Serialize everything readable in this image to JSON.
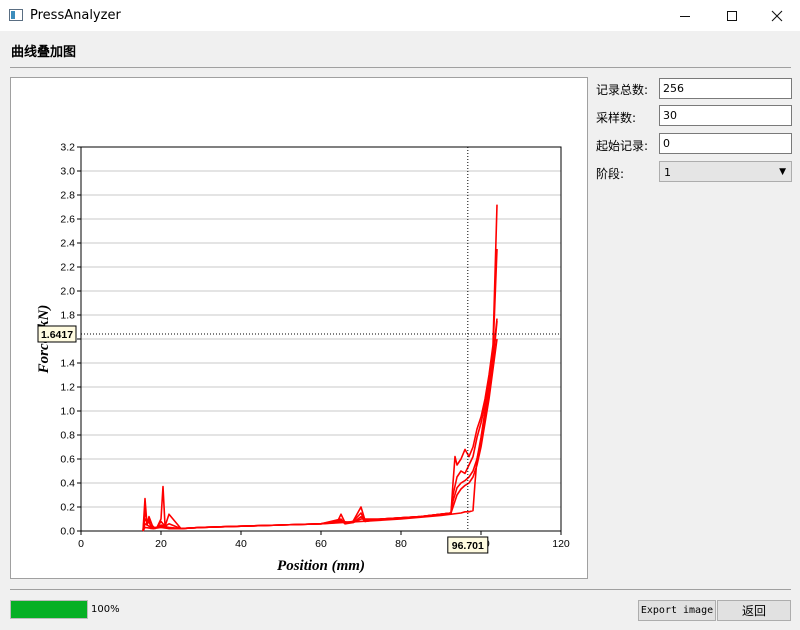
{
  "window": {
    "title": "PressAnalyzer"
  },
  "section_title": "曲线叠加图",
  "fields": {
    "total_records": {
      "label": "记录总数:",
      "value": "256"
    },
    "samples": {
      "label": "采样数:",
      "value": "30"
    },
    "start_record": {
      "label": "起始记录:",
      "value": "0"
    },
    "stage": {
      "label": "阶段:",
      "value": "1"
    }
  },
  "progress": {
    "percent": 100,
    "text": "100%"
  },
  "buttons": {
    "export": "Export image",
    "back": "返回"
  },
  "icons": {
    "minimize": "minimize-icon",
    "maximize": "maximize-icon",
    "close": "close-icon",
    "dropdown": "chevron-down-icon",
    "app": "app-icon"
  },
  "chart_data": {
    "type": "line",
    "xlabel": "Position (mm)",
    "ylabel": "Force (kN)",
    "xlim": [
      0,
      120
    ],
    "ylim": [
      0,
      3.2
    ],
    "xticks": [
      0,
      20,
      40,
      60,
      80,
      100,
      120
    ],
    "yticks": [
      0.0,
      0.2,
      0.4,
      0.6,
      0.8,
      1.0,
      1.2,
      1.4,
      1.6,
      1.8,
      2.0,
      2.2,
      2.4,
      2.6,
      2.8,
      3.0,
      3.2
    ],
    "grid": "horizontal",
    "color": "#ff0000",
    "cursor": {
      "x": 96.701,
      "y": 1.6417,
      "x_label": "96.701",
      "y_label": "1.6417"
    },
    "series": [
      {
        "x": [
          15.5,
          16,
          16.5,
          17,
          17.5,
          18,
          18.5,
          19,
          20,
          20.5,
          21,
          21.5,
          22,
          23,
          25,
          30,
          40,
          50,
          60,
          64,
          65,
          66,
          68,
          70,
          71,
          75,
          80,
          85,
          90,
          92.5,
          93,
          93.5,
          94,
          95,
          96,
          97,
          98,
          99,
          100,
          101,
          102,
          103,
          104
        ],
        "y": [
          0.0,
          0.27,
          0.05,
          0.1,
          0.02,
          0.04,
          0.02,
          0.03,
          0.1,
          0.37,
          0.05,
          0.03,
          0.02,
          0.02,
          0.02,
          0.03,
          0.04,
          0.05,
          0.06,
          0.07,
          0.14,
          0.07,
          0.08,
          0.2,
          0.09,
          0.1,
          0.11,
          0.12,
          0.14,
          0.15,
          0.4,
          0.62,
          0.55,
          0.6,
          0.68,
          0.62,
          0.7,
          0.85,
          0.95,
          1.1,
          1.3,
          1.55,
          2.72
        ]
      },
      {
        "x": [
          15.5,
          16,
          16.5,
          17,
          18,
          19,
          20,
          21,
          22,
          25,
          30,
          40,
          50,
          60,
          65,
          66,
          68,
          70,
          71,
          75,
          80,
          85,
          90,
          92.5,
          93,
          94,
          95,
          96,
          97,
          98,
          99,
          100,
          101,
          102,
          103,
          104
        ],
        "y": [
          0.0,
          0.18,
          0.06,
          0.12,
          0.03,
          0.03,
          0.08,
          0.04,
          0.14,
          0.02,
          0.03,
          0.04,
          0.05,
          0.06,
          0.1,
          0.06,
          0.08,
          0.15,
          0.08,
          0.1,
          0.11,
          0.12,
          0.14,
          0.15,
          0.3,
          0.45,
          0.5,
          0.48,
          0.55,
          0.62,
          0.78,
          0.9,
          1.05,
          1.25,
          1.5,
          2.35
        ]
      },
      {
        "x": [
          15.5,
          16,
          17,
          18,
          19,
          20,
          21,
          22,
          25,
          30,
          40,
          50,
          60,
          65,
          66,
          68,
          70,
          71,
          75,
          80,
          85,
          90,
          92.5,
          93,
          94,
          95,
          96,
          97,
          98,
          99,
          100,
          101,
          102,
          103,
          104
        ],
        "y": [
          0.0,
          0.1,
          0.07,
          0.02,
          0.03,
          0.05,
          0.04,
          0.06,
          0.02,
          0.03,
          0.04,
          0.05,
          0.06,
          0.09,
          0.06,
          0.07,
          0.12,
          0.08,
          0.1,
          0.11,
          0.12,
          0.14,
          0.15,
          0.25,
          0.36,
          0.4,
          0.42,
          0.45,
          0.5,
          0.6,
          0.75,
          0.95,
          1.15,
          1.4,
          1.75
        ]
      },
      {
        "x": [
          15.5,
          16,
          17,
          18,
          20,
          22,
          25,
          30,
          40,
          50,
          60,
          65,
          68,
          70,
          75,
          80,
          85,
          90,
          92.5,
          93,
          94,
          95,
          96,
          97,
          98,
          99,
          100,
          101,
          102,
          103,
          104
        ],
        "y": [
          0.0,
          0.06,
          0.04,
          0.02,
          0.04,
          0.03,
          0.02,
          0.03,
          0.04,
          0.05,
          0.06,
          0.08,
          0.07,
          0.1,
          0.1,
          0.11,
          0.12,
          0.14,
          0.15,
          0.2,
          0.3,
          0.35,
          0.38,
          0.4,
          0.45,
          0.55,
          0.7,
          0.9,
          1.1,
          1.35,
          1.6
        ]
      },
      {
        "x": [
          15.5,
          16,
          18,
          20,
          22,
          25,
          30,
          40,
          50,
          60,
          70,
          80,
          90,
          95,
          96,
          97,
          98,
          98.5,
          99,
          100,
          101,
          102,
          103,
          104
        ],
        "y": [
          0.0,
          0.03,
          0.02,
          0.03,
          0.02,
          0.02,
          0.03,
          0.04,
          0.05,
          0.06,
          0.08,
          0.1,
          0.13,
          0.15,
          0.16,
          0.16,
          0.17,
          0.4,
          0.6,
          0.78,
          1.0,
          1.2,
          1.45,
          1.77
        ]
      }
    ]
  }
}
